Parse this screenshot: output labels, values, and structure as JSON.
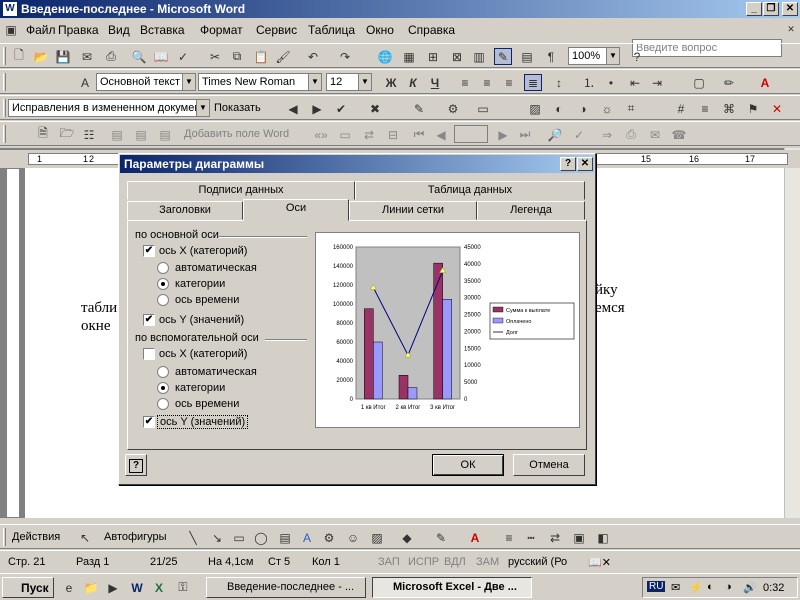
{
  "window": {
    "title": "Введение-последнее - Microsoft Word",
    "app_icon": "W"
  },
  "menu": [
    "Файл",
    "Правка",
    "Вид",
    "Вставка",
    "Формат",
    "Сервис",
    "Таблица",
    "Окно",
    "Справка"
  ],
  "ask_placeholder": "Введите вопрос",
  "toolbar_std": {
    "zoom": "100%"
  },
  "toolbar_fmt": {
    "style": "Основной текст",
    "font": "Times New Roman",
    "size": "12",
    "bold": "Ж",
    "italic": "К",
    "underline": "Ч"
  },
  "toolbar_review": {
    "mode": "Исправления в измененном документ",
    "show": "Показать"
  },
  "toolbar_mail": {
    "add_field": "Добавить поле Word"
  },
  "ruler": {
    "marks": [
      "1",
      "1",
      "2",
      "3",
      "15",
      "16",
      "17"
    ]
  },
  "doc_text": {
    "line1_left": "табли",
    "line2_left": "окне",
    "line1_right": "йку",
    "line2_right": "емся"
  },
  "dialog": {
    "title": "Параметры диаграммы",
    "tabs_back": [
      "Подписи данных",
      "Таблица данных"
    ],
    "tabs_front": [
      "Заголовки",
      "Оси",
      "Линии сетки",
      "Легенда"
    ],
    "primary_group": "по основной оси",
    "primary": {
      "x_axis": "ось X (категорий)",
      "options": [
        "автоматическая",
        "категории",
        "ось времени"
      ],
      "y_axis": "ось Y (значений)"
    },
    "secondary_group": "по вспомогательной оси",
    "secondary": {
      "x_axis": "ось X (категорий)",
      "options": [
        "автоматическая",
        "категории",
        "ось времени"
      ],
      "y_axis": "ось Y (значений)"
    },
    "ok": "ОК",
    "cancel": "Отмена"
  },
  "chart_data": {
    "type": "bar",
    "categories": [
      "1 кв Итог",
      "2 кв Итог",
      "3 кв Итог"
    ],
    "series": [
      {
        "name": "Сумма к выплате",
        "values": [
          95000,
          25000,
          143000
        ],
        "color": "#993366",
        "axis": "primary"
      },
      {
        "name": "Оплачено",
        "values": [
          60000,
          12000,
          105000
        ],
        "color": "#9999ff",
        "axis": "primary"
      },
      {
        "name": "Долг",
        "values": [
          33000,
          13000,
          38000
        ],
        "color": "#000080",
        "type": "line",
        "axis": "secondary"
      }
    ],
    "y_ticks": [
      "160000",
      "140000",
      "120000",
      "100000",
      "80000",
      "60000",
      "40000",
      "20000",
      "0"
    ],
    "y2_ticks": [
      "45000",
      "40000",
      "35000",
      "30000",
      "25000",
      "20000",
      "15000",
      "10000",
      "5000",
      "0"
    ],
    "ylim": [
      0,
      160000
    ],
    "y2lim": [
      0,
      45000
    ],
    "legend_position": "right"
  },
  "drawbar": {
    "actions": "Действия",
    "autoshapes": "Автофигуры"
  },
  "status": {
    "page": "Стр. 21",
    "section": "Разд 1",
    "pages": "21/25",
    "at": "На 4,1см",
    "line": "Ст 5",
    "col": "Кол 1",
    "rec": "ЗАП",
    "trk": "ИСПР",
    "ext": "ВДЛ",
    "ovr": "ЗАМ",
    "lang": "русский (Ро"
  },
  "taskbar": {
    "start": "Пуск",
    "task_word": "Введение-последнее - ...",
    "task_excel": "Microsoft Excel - Две ...",
    "lang": "RU",
    "time": "0:32"
  }
}
